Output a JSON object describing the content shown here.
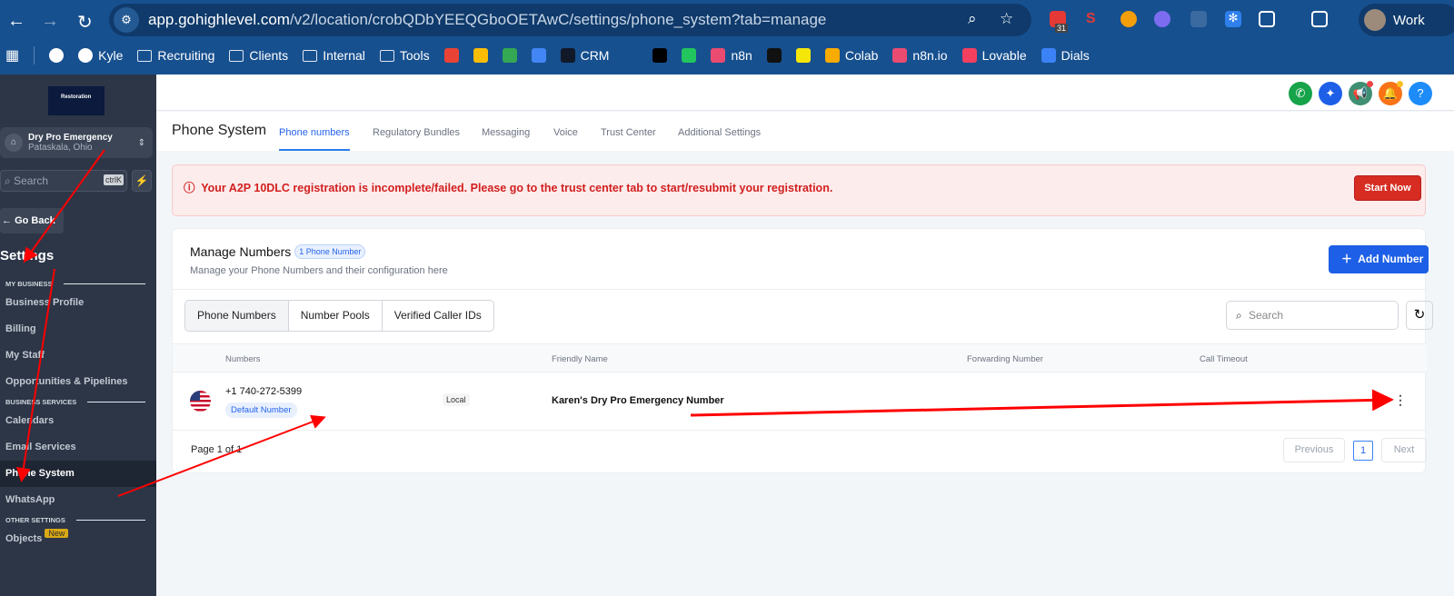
{
  "browser": {
    "url_host": "app.gohighlevel.com",
    "url_path": "/v2/location/crobQDbYEEQGboOETAwC/settings/phone_system?tab=manage",
    "profile": "Work",
    "calendar_badge": "31",
    "bookmarks": [
      {
        "label": "",
        "icon": "t-icon",
        "color": "#ffffff"
      },
      {
        "label": "Kyle",
        "icon": "t-icon",
        "color": "#ffffff"
      },
      {
        "label": "Recruiting",
        "icon": "folder-icon"
      },
      {
        "label": "Clients",
        "icon": "folder-icon"
      },
      {
        "label": "Internal",
        "icon": "folder-icon"
      },
      {
        "label": "Tools",
        "icon": "folder-icon"
      },
      {
        "label": "",
        "icon": "gmail-icon",
        "color": "#ea4335"
      },
      {
        "label": "",
        "icon": "drive-icon",
        "color": "#fbbc04"
      },
      {
        "label": "",
        "icon": "sheets-icon",
        "color": "#34a853"
      },
      {
        "label": "",
        "icon": "calendar-icon",
        "color": "#4285f4"
      },
      {
        "label": "CRM",
        "icon": "crm-icon",
        "color": "#111827"
      },
      {
        "label": "",
        "icon": "openai-icon",
        "color": "#17508f"
      },
      {
        "label": "",
        "icon": "app-icon",
        "color": "#000000"
      },
      {
        "label": "",
        "icon": "p-icon",
        "color": "#22c55e"
      },
      {
        "label": "n8n",
        "icon": "n8n-icon",
        "color": "#ea4b71"
      },
      {
        "label": "",
        "icon": "d7-icon",
        "color": "#111111"
      },
      {
        "label": "",
        "icon": "asterisk-icon",
        "color": "#f5e60a"
      },
      {
        "label": "Colab",
        "icon": "colab-icon",
        "color": "#f9ab00"
      },
      {
        "label": "n8n.io",
        "icon": "n8n-icon",
        "color": "#ea4b71"
      },
      {
        "label": "Lovable",
        "icon": "lovable-icon",
        "color": "#f43f5e"
      },
      {
        "label": "Dials",
        "icon": "chart-icon",
        "color": "#3b82f6"
      }
    ]
  },
  "sidebar": {
    "logo_text": "Restoration",
    "account_name": "Dry Pro Emergency",
    "account_location": "Pataskala, Ohio",
    "search_placeholder": "Search",
    "search_shortcut": "ctrlK",
    "go_back": "Go Back",
    "title": "Settings",
    "sections": [
      {
        "label": "MY BUSINESS",
        "items": [
          "Business Profile",
          "Billing",
          "My Staff",
          "Opportunities & Pipelines"
        ]
      },
      {
        "label": "BUSINESS SERVICES",
        "items": [
          "Calendars",
          "Email Services",
          "Phone System",
          "WhatsApp"
        ]
      },
      {
        "label": "OTHER SETTINGS",
        "items": [
          "Objects"
        ]
      }
    ],
    "active_item": "Phone System",
    "new_badge": "New"
  },
  "header_icons": [
    {
      "icon": "phone-icon",
      "color": "#16a34a"
    },
    {
      "icon": "sparkle-icon",
      "color": "#1d5fe6"
    },
    {
      "icon": "megaphone-icon",
      "color": "#3f8f72"
    },
    {
      "icon": "bell-icon",
      "color": "#f97316"
    },
    {
      "icon": "help-icon",
      "color": "#1d8cf8"
    }
  ],
  "page": {
    "title": "Phone System",
    "tabs": [
      "Phone numbers",
      "Regulatory Bundles",
      "Messaging",
      "Voice",
      "Trust Center",
      "Additional Settings"
    ],
    "active_tab": "Phone numbers"
  },
  "banner": {
    "message": "Your A2P 10DLC registration is incomplete/failed. Please go to the trust center tab to start/resubmit your registration.",
    "button": "Start Now"
  },
  "manage": {
    "title": "Manage Numbers",
    "count_badge": "1 Phone Number",
    "subtitle": "Manage your Phone Numbers and their configuration here",
    "add_button": "Add Number",
    "segments": [
      "Phone Numbers",
      "Number Pools",
      "Verified Caller IDs"
    ],
    "search_placeholder": "Search",
    "columns": [
      "Numbers",
      "Friendly Name",
      "Forwarding Number",
      "Call Timeout"
    ],
    "rows": [
      {
        "number": "+1 740-272-5399",
        "default_badge": "Default Number",
        "type": "Local",
        "friendly_name": "Karen's Dry Pro Emergency Number",
        "forwarding": "",
        "timeout": ""
      }
    ],
    "pagination": {
      "label": "Page 1 of 1",
      "previous": "Previous",
      "current": "1",
      "next": "Next"
    }
  },
  "annotation_color": "#ff0000"
}
